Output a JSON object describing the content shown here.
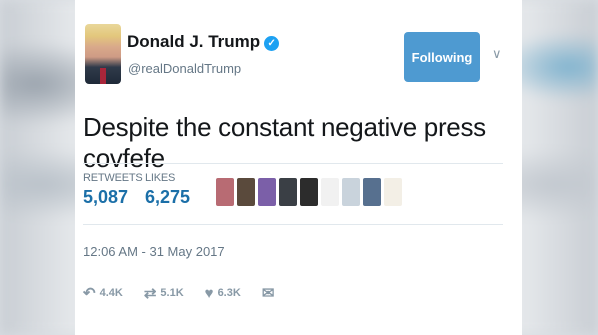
{
  "tweet": {
    "author_name": "Donald J. Trump",
    "handle": "@realDonaldTrump",
    "follow_label": "Following",
    "text": "Despite the constant negative press covfefe",
    "stats": {
      "retweets_label": "RETWEETS",
      "retweets_value": "5,087",
      "likes_label": "LIKES",
      "likes_value": "6,275"
    },
    "timestamp": "12:06 AM - 31 May 2017",
    "actions": {
      "reply_count": "4.4K",
      "retweet_count": "5.1K",
      "like_count": "6.3K"
    }
  },
  "colors": {
    "accent": "#4e9ad1",
    "stat_number": "#1b6fa8",
    "verified": "#1da1f2"
  },
  "icons": [
    "verified-badge-icon",
    "chevron-down-icon",
    "reply-icon",
    "retweet-icon",
    "heart-icon",
    "direct-message-icon"
  ]
}
